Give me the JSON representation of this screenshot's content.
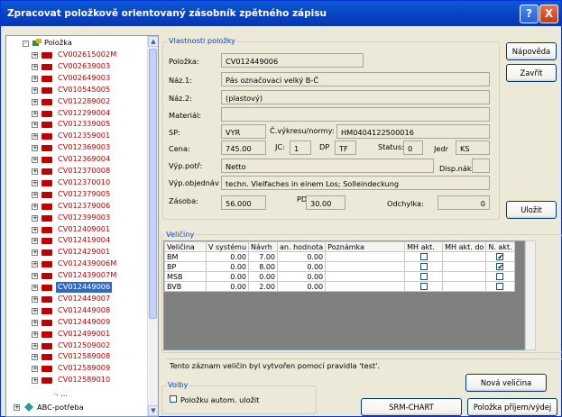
{
  "window": {
    "title": "Zpracovat položkově orientovaný zásobník zpětného zápisu",
    "help_glyph": "?",
    "close_glyph": "X"
  },
  "tree": {
    "root_label": "Položka",
    "items": [
      "CV002615002M",
      "CV002639003",
      "CV002649003",
      "CV010545005",
      "CV012289002",
      "CV012299004",
      "CV012339005",
      "CV012359001",
      "CV012369003",
      "CV012369004",
      "CV012370008",
      "CV012370010",
      "CV012379005",
      "CV012379006",
      "CV012399003",
      "CV012409001",
      "CV012419004",
      "CV012429001",
      "CV012439006M",
      "CV012439007M",
      "CV012449006",
      "CV012449007",
      "CV012449008",
      "CV012449009",
      "CV012499001",
      "CV012509002",
      "CV012589008",
      "CV012589009",
      "CV012589010"
    ],
    "selected_index": 20,
    "ellipsis": "...",
    "bottom_label": "ABC-potřeba",
    "expand_plus": "+",
    "expand_minus": "-"
  },
  "props": {
    "group_label": "Vlastnosti položky",
    "polozka_label": "Položka:",
    "polozka_value": "CV012449006",
    "naz1_label": "Náz.1:",
    "naz1_value": "Pás označovací velký B-Č",
    "naz2_label": "Náz.2:",
    "naz2_value": "(plastový)",
    "material_label": "Materiál:",
    "material_value": "",
    "sp_label": "SP:",
    "sp_value": "VYR",
    "vykres_label": "Č.výkresu/normy:",
    "vykres_value": "HM0404122500016",
    "cena_label": "Cena:",
    "cena_value": "745.00",
    "jc_label": "JC:",
    "jc_value": "1",
    "dp_label": "DP",
    "dp_value": "TF",
    "status_label": "Status:",
    "status_value": "0",
    "jedr_label": "Jedr",
    "jedr_value": "KS",
    "vyp_potr_label": "Výp.potř:",
    "vyp_potr_value": "Netto",
    "disp_label": "Disp.nák.",
    "disp_value": "",
    "vyp_obj_label": "Výp.objednáv",
    "vyp_obj_value": "techn. Vielfaches in einem Los; Solleindeckung",
    "zasoba_label": "Zásoba:",
    "zasoba_value": "56.000",
    "pdv_label": "PDV-skup",
    "pdv_value": "30.00",
    "odch_label": "Odchylka:",
    "odch_value": "0"
  },
  "buttons": {
    "napoveda": "Nápověda",
    "zavrit": "Zavřít",
    "ulozit": "Uložit",
    "nova_velicina": "Nová veličina",
    "srm_chart": "SRM-CHART",
    "polozka_prijem": "Položka příjem/výdej"
  },
  "veliciny": {
    "group_label": "Veličiny",
    "columns": [
      "Veličina",
      "V systému",
      "Návrh",
      "an. hodnota",
      "Poznámka",
      "MH akt.",
      "MH akt. do",
      "N. akt."
    ],
    "rows": [
      {
        "name": "BM",
        "system": "0.00",
        "navrh": "7.00",
        "hodnota": "0.00",
        "poznamka": "",
        "n_akt": "✔"
      },
      {
        "name": "BP",
        "system": "0.00",
        "navrh": "8.00",
        "hodnota": "0.00",
        "poznamka": "",
        "n_akt": "✔"
      },
      {
        "name": "MSB",
        "system": "0.00",
        "navrh": "0.00",
        "hodnota": "0.00",
        "poznamka": "",
        "n_akt": ""
      },
      {
        "name": "BVB",
        "system": "0.00",
        "navrh": "2.00",
        "hodnota": "0.00",
        "poznamka": "",
        "n_akt": ""
      }
    ]
  },
  "note": "Tento záznam veličin byl vytvořen pomocí pravidla 'test'.",
  "volby": {
    "group_label": "Volby",
    "checkbox_label": "Položku autom. uložit"
  },
  "colors": {
    "title_bar": "#0741c0",
    "tree_item": "#c00000",
    "selection": "#316ac5",
    "group_label": "#0046d5"
  }
}
